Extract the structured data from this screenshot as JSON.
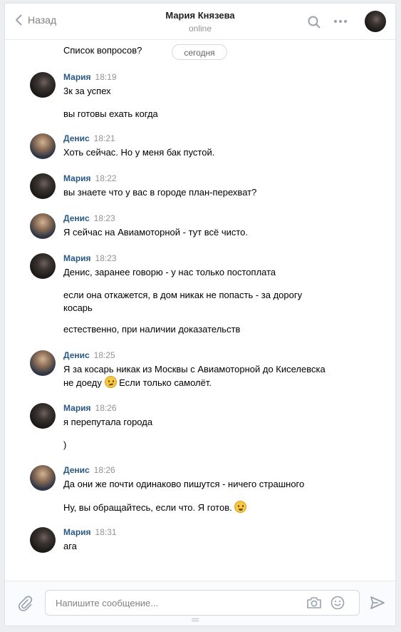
{
  "header": {
    "back_label": "Назад",
    "title": "Мария Князева",
    "status": "online"
  },
  "history": {
    "top_cut_text": "Список вопросов?",
    "date_divider": "сегодня",
    "groups": [
      {
        "author": "Мария",
        "time": "18:19",
        "lines": [
          "3к за успех",
          "вы готовы ехать когда"
        ]
      },
      {
        "author": "Денис",
        "time": "18:21",
        "lines": [
          "Хоть сейчас. Но у меня бак пустой."
        ]
      },
      {
        "author": "Мария",
        "time": "18:22",
        "lines": [
          "вы знаете что у вас в городе план-перехват?"
        ]
      },
      {
        "author": "Денис",
        "time": "18:23",
        "lines": [
          "Я сейчас на Авиамоторной - тут всё чисто."
        ]
      },
      {
        "author": "Мария",
        "time": "18:23",
        "lines": [
          "Денис, заранее говорю - у нас только постоплата",
          "если она откажется, в дом никак не попасть - за дорогу",
          "косарь",
          "естественно, при наличии доказательств"
        ]
      },
      {
        "author": "Денис",
        "time": "18:25",
        "lines": [
          "Я за косарь никак из Москвы с Авиамоторной до Киселевска",
          "не доеду",
          "Если только самолёт."
        ]
      },
      {
        "author": "Мария",
        "time": "18:26",
        "lines": [
          "я перепутала города",
          ")"
        ]
      },
      {
        "author": "Денис",
        "time": "18:26",
        "lines": [
          "Да они же почти одинаково пишутся - ничего страшного",
          "Ну, вы обращайтесь, если что. Я готов."
        ]
      },
      {
        "author": "Мария",
        "time": "18:31",
        "lines": [
          "ага"
        ]
      }
    ]
  },
  "emoji": {
    "thinking": "thinking-face-icon",
    "wink": "winking-face-icon"
  },
  "composer": {
    "placeholder": "Напишите сообщение..."
  }
}
